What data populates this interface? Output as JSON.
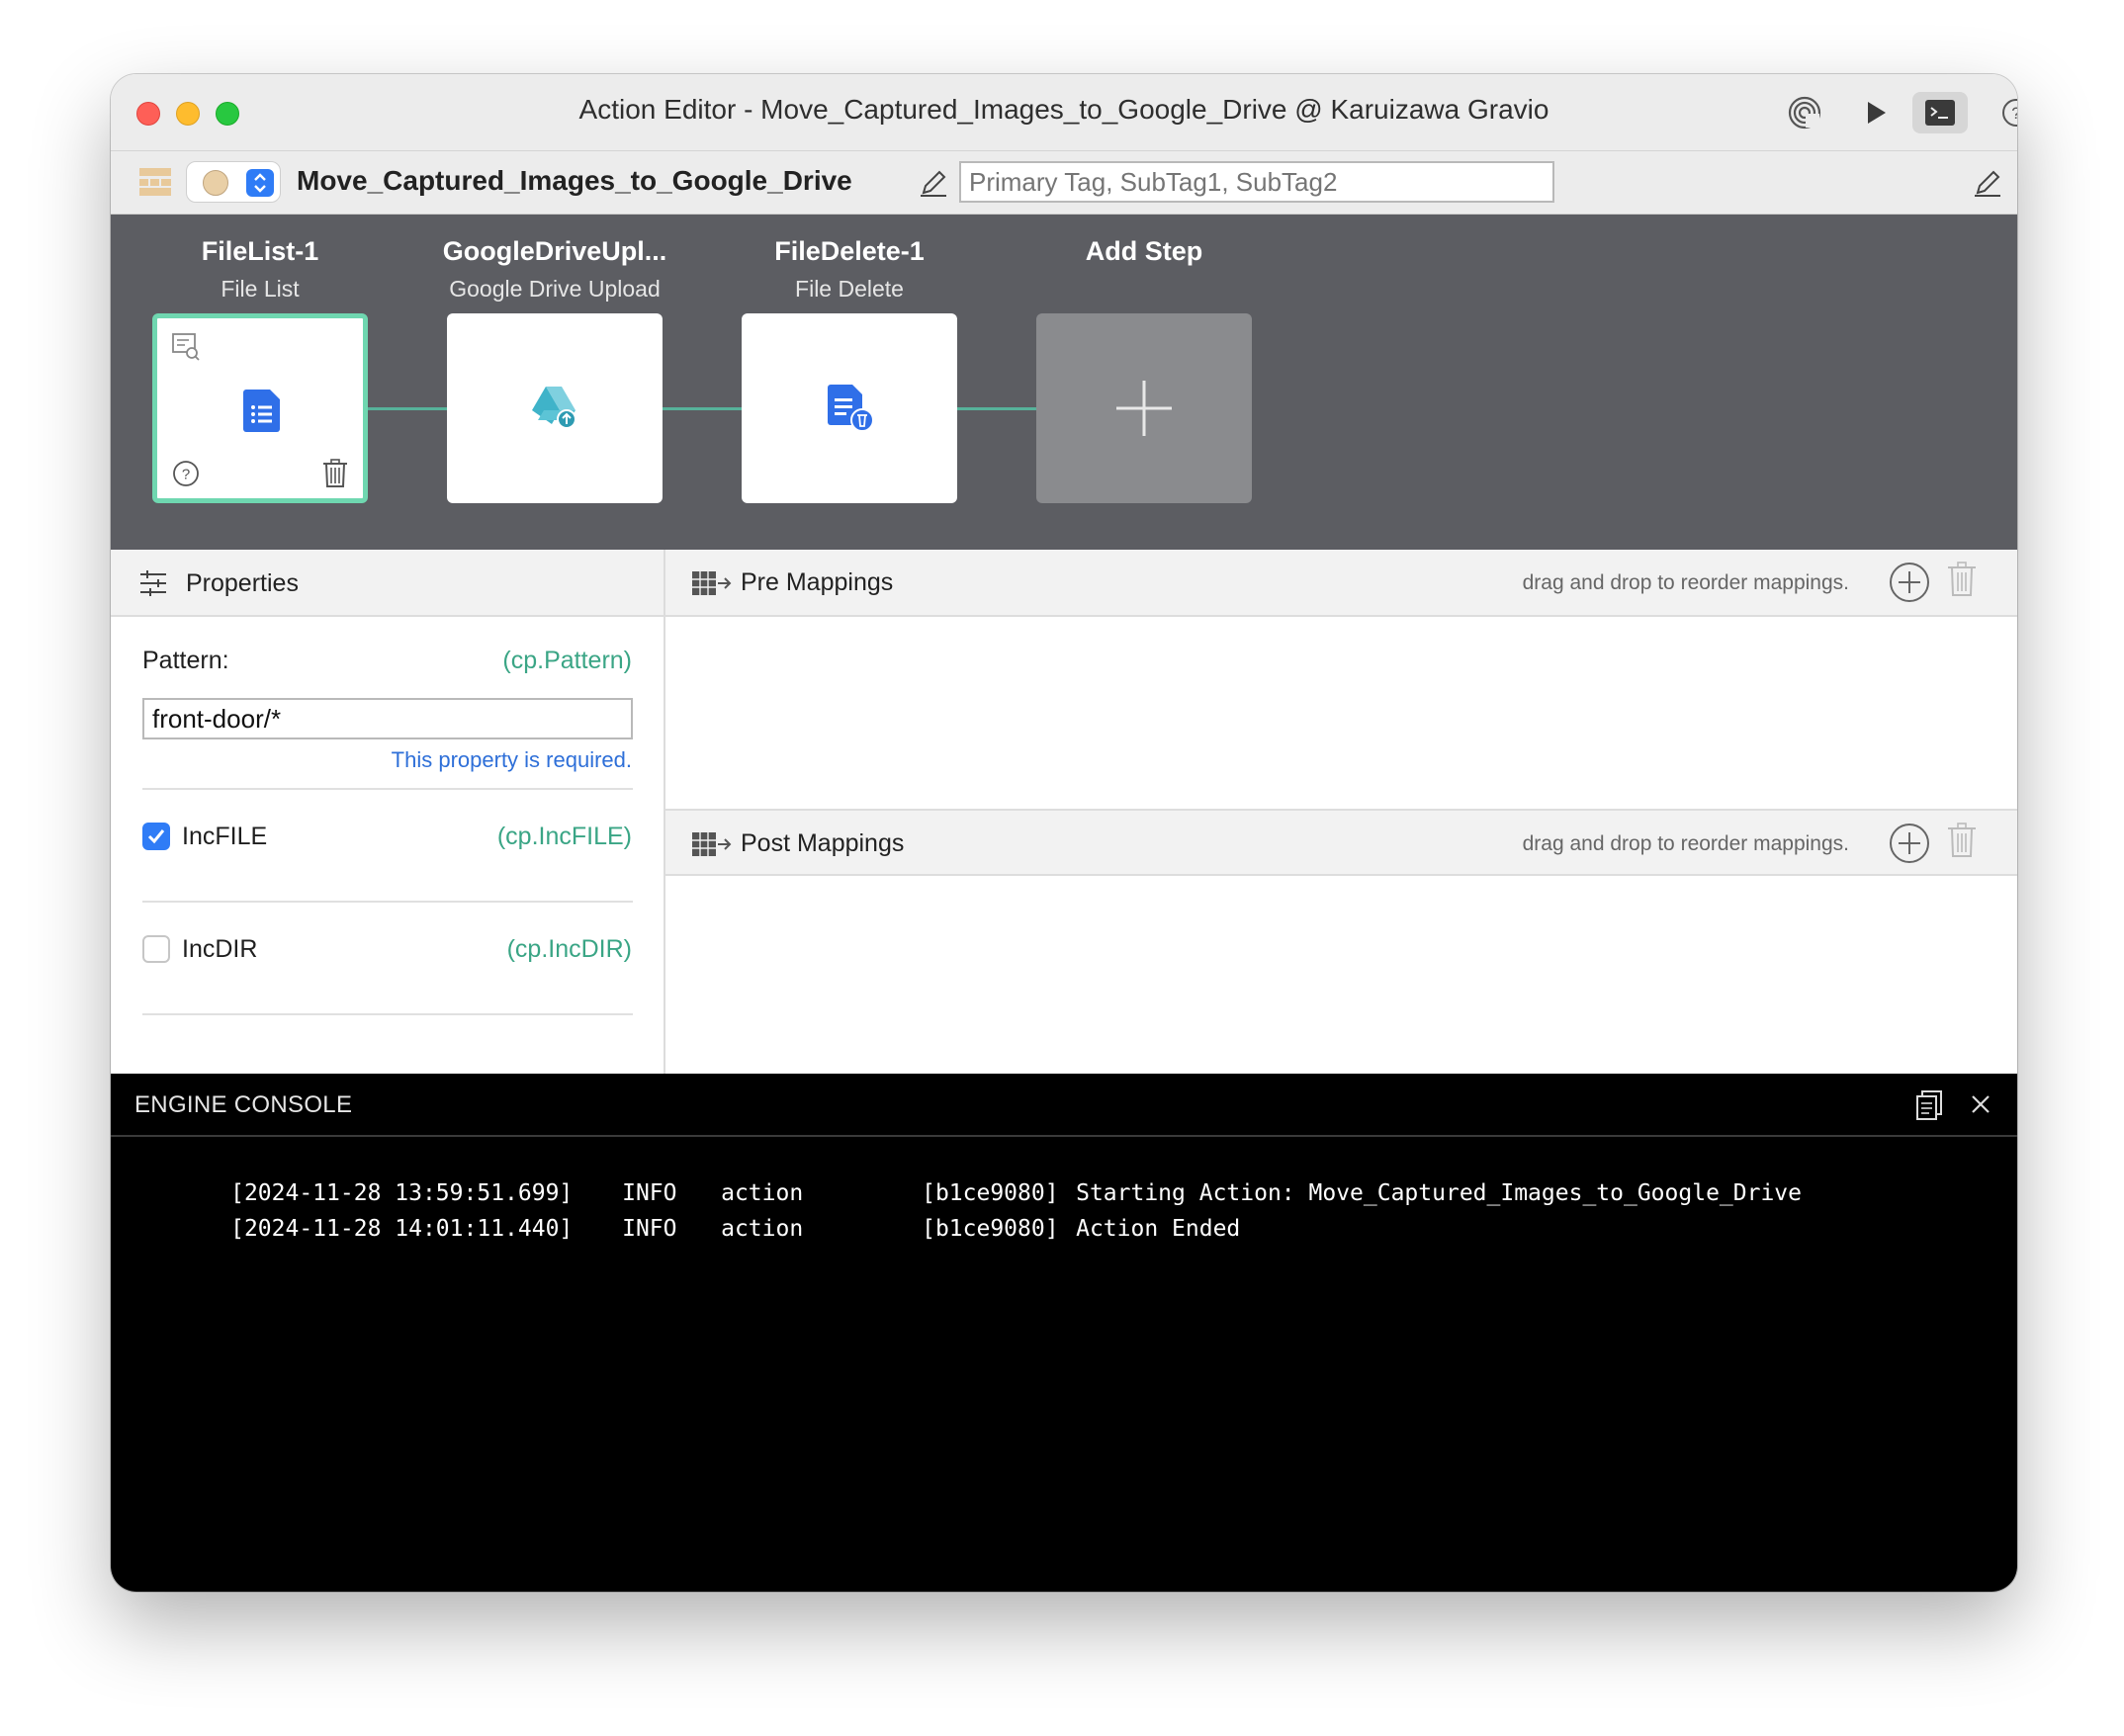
{
  "window": {
    "title": "Action Editor - Move_Captured_Images_to_Google_Drive @ Karuizawa Gravio",
    "toolbar_icons": [
      "broadcast-icon",
      "play-icon",
      "terminal-icon",
      "help-icon"
    ]
  },
  "action": {
    "name": "Move_Captured_Images_to_Google_Drive",
    "tag_placeholder": "Primary Tag, SubTag1, SubTag2",
    "color": "#e9cfa6"
  },
  "steps": [
    {
      "title": "FileList-1",
      "subtitle": "File List",
      "icon": "file-list-icon",
      "selected": true
    },
    {
      "title": "GoogleDriveUpl...",
      "subtitle": "Google Drive Upload",
      "icon": "google-drive-upload-icon",
      "selected": false
    },
    {
      "title": "FileDelete-1",
      "subtitle": "File Delete",
      "icon": "file-delete-icon",
      "selected": false
    },
    {
      "title": "Add Step",
      "subtitle": "",
      "icon": "plus-icon",
      "selected": false
    }
  ],
  "properties": {
    "header": "Properties",
    "pattern_label": "Pattern:",
    "pattern_var": "(cp.Pattern)",
    "pattern_value": "front-door/*",
    "pattern_required": "This property is required.",
    "incfile_label": "IncFILE",
    "incfile_var": "(cp.IncFILE)",
    "incfile_checked": true,
    "incdir_label": "IncDIR",
    "incdir_var": "(cp.IncDIR)",
    "incdir_checked": false
  },
  "pre_mappings": {
    "label": "Pre Mappings",
    "hint": "drag and drop to reorder mappings."
  },
  "post_mappings": {
    "label": "Post Mappings",
    "hint": "drag and drop to reorder mappings."
  },
  "console": {
    "title": "ENGINE CONSOLE",
    "lines": [
      {
        "ts": "[2024-11-28 13:59:51.699]",
        "level": "INFO",
        "cat": "action",
        "id": "[b1ce9080]",
        "msg": "Starting Action: Move_Captured_Images_to_Google_Drive"
      },
      {
        "ts": "[2024-11-28 14:01:11.440]",
        "level": "INFO",
        "cat": "action",
        "id": "[b1ce9080]",
        "msg": "Action Ended"
      }
    ]
  },
  "colors": {
    "accent": "#2f7cf6",
    "selection_border": "#6fd7b0",
    "variable_text": "#3aa585",
    "steps_bg": "#5c5d62"
  }
}
